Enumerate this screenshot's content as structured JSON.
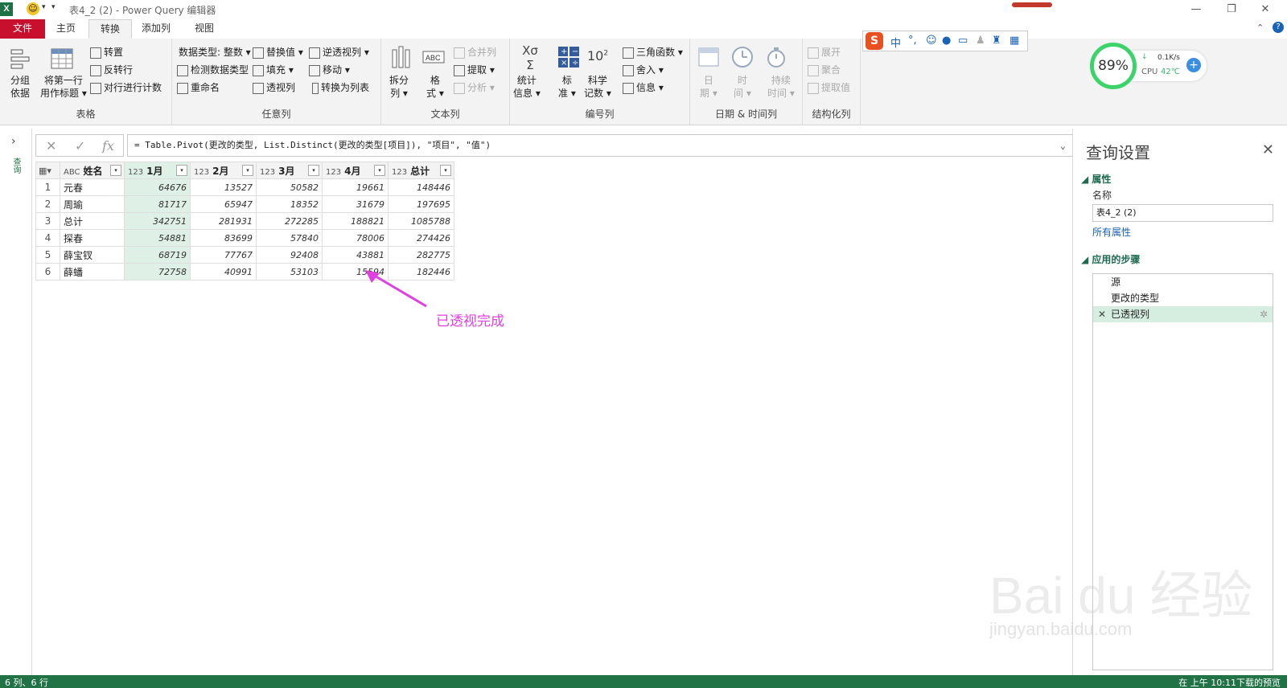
{
  "window": {
    "title": "表4_2 (2) - Power Query 编辑器",
    "app_logo": "X"
  },
  "tabs": [
    {
      "label": "文件"
    },
    {
      "label": "主页"
    },
    {
      "label": "转换"
    },
    {
      "label": "添加列"
    },
    {
      "label": "视图"
    }
  ],
  "ribbon": {
    "table_group": {
      "label": "表格",
      "group_by": [
        "分组",
        "依据"
      ],
      "use_first_row": [
        "将第一行",
        "用作标题"
      ],
      "transpose": "转置",
      "reverse_rows": "反转行",
      "count_rows": "对行进行计数"
    },
    "any_column_group": {
      "label": "任意列",
      "data_type": "数据类型: 整数",
      "detect_type": "检测数据类型",
      "rename": "重命名",
      "replace_values": "替换值",
      "fill": "填充",
      "pivot": "透视列",
      "unpivot": "逆透视列",
      "move": "移动",
      "to_list": "转换为列表"
    },
    "text_group": {
      "label": "文本列",
      "split": [
        "拆分",
        "列"
      ],
      "format": [
        "格",
        "式"
      ],
      "merge": "合并列",
      "extract": "提取",
      "parse": "分析"
    },
    "number_group": {
      "label": "编号列",
      "statistics": [
        "统计",
        "信息"
      ],
      "standard": [
        "标",
        "准"
      ],
      "scientific": [
        "科学",
        "记数"
      ],
      "trig": "三角函数",
      "rounding": "舍入",
      "information": "信息"
    },
    "datetime_group": {
      "label": "日期 & 时间列",
      "date": [
        "日",
        "期"
      ],
      "time": [
        "时",
        "间"
      ],
      "duration": [
        "持续",
        "时间"
      ]
    },
    "structured_group": {
      "label": "结构化列",
      "expand": "展开",
      "aggregate": "聚合",
      "extract_values": "提取值"
    }
  },
  "ime": {
    "logo": "S",
    "mode": "中"
  },
  "cpu_widget": {
    "percent": "89%",
    "speed": "0.1K/s",
    "cpu_label": "CPU",
    "temp": "42℃"
  },
  "formula_bar": {
    "cancel": "✕",
    "commit": "✓",
    "fx": "fx",
    "formula": "= Table.Pivot(更改的类型, List.Distinct(更改的类型[项目]), \"项目\", \"值\")"
  },
  "grid": {
    "columns": [
      {
        "type": "ABC",
        "name": "姓名"
      },
      {
        "type": "123",
        "name": "1月"
      },
      {
        "type": "123",
        "name": "2月"
      },
      {
        "type": "123",
        "name": "3月"
      },
      {
        "type": "123",
        "name": "4月"
      },
      {
        "type": "123",
        "name": "总计"
      }
    ],
    "rows": [
      {
        "no": "1",
        "cells": [
          "元春",
          "64676",
          "13527",
          "50582",
          "19661",
          "148446"
        ]
      },
      {
        "no": "2",
        "cells": [
          "周瑜",
          "81717",
          "65947",
          "18352",
          "31679",
          "197695"
        ]
      },
      {
        "no": "3",
        "cells": [
          "总计",
          "342751",
          "281931",
          "272285",
          "188821",
          "1085788"
        ]
      },
      {
        "no": "4",
        "cells": [
          "探春",
          "54881",
          "83699",
          "57840",
          "78006",
          "274426"
        ]
      },
      {
        "no": "5",
        "cells": [
          "薛宝钗",
          "68719",
          "77767",
          "92408",
          "43881",
          "282775"
        ]
      },
      {
        "no": "6",
        "cells": [
          "薛蟠",
          "72758",
          "40991",
          "53103",
          "15594",
          "182446"
        ]
      }
    ]
  },
  "annotation": {
    "text": "已透视完成",
    "color": "#e040e0"
  },
  "left_nav": {
    "label": "查询"
  },
  "settings": {
    "title": "查询设置",
    "properties_heading": "属性",
    "name_label": "名称",
    "name_value": "表4_2 (2)",
    "all_properties": "所有属性",
    "steps_heading": "应用的步骤",
    "steps": [
      {
        "label": "源"
      },
      {
        "label": "更改的类型"
      },
      {
        "label": "已透视列",
        "active": true
      }
    ]
  },
  "status": {
    "left": "6 列、6 行",
    "right": "在 上午 10:11下载的预览"
  },
  "watermark": {
    "brand": "Bai du 经验",
    "url": "jingyan.baidu.com"
  },
  "colors": {
    "accent_green": "#217346",
    "file_tab": "#c8102e",
    "selected_column": "#dff0e6",
    "active_step": "#d5eee0"
  }
}
